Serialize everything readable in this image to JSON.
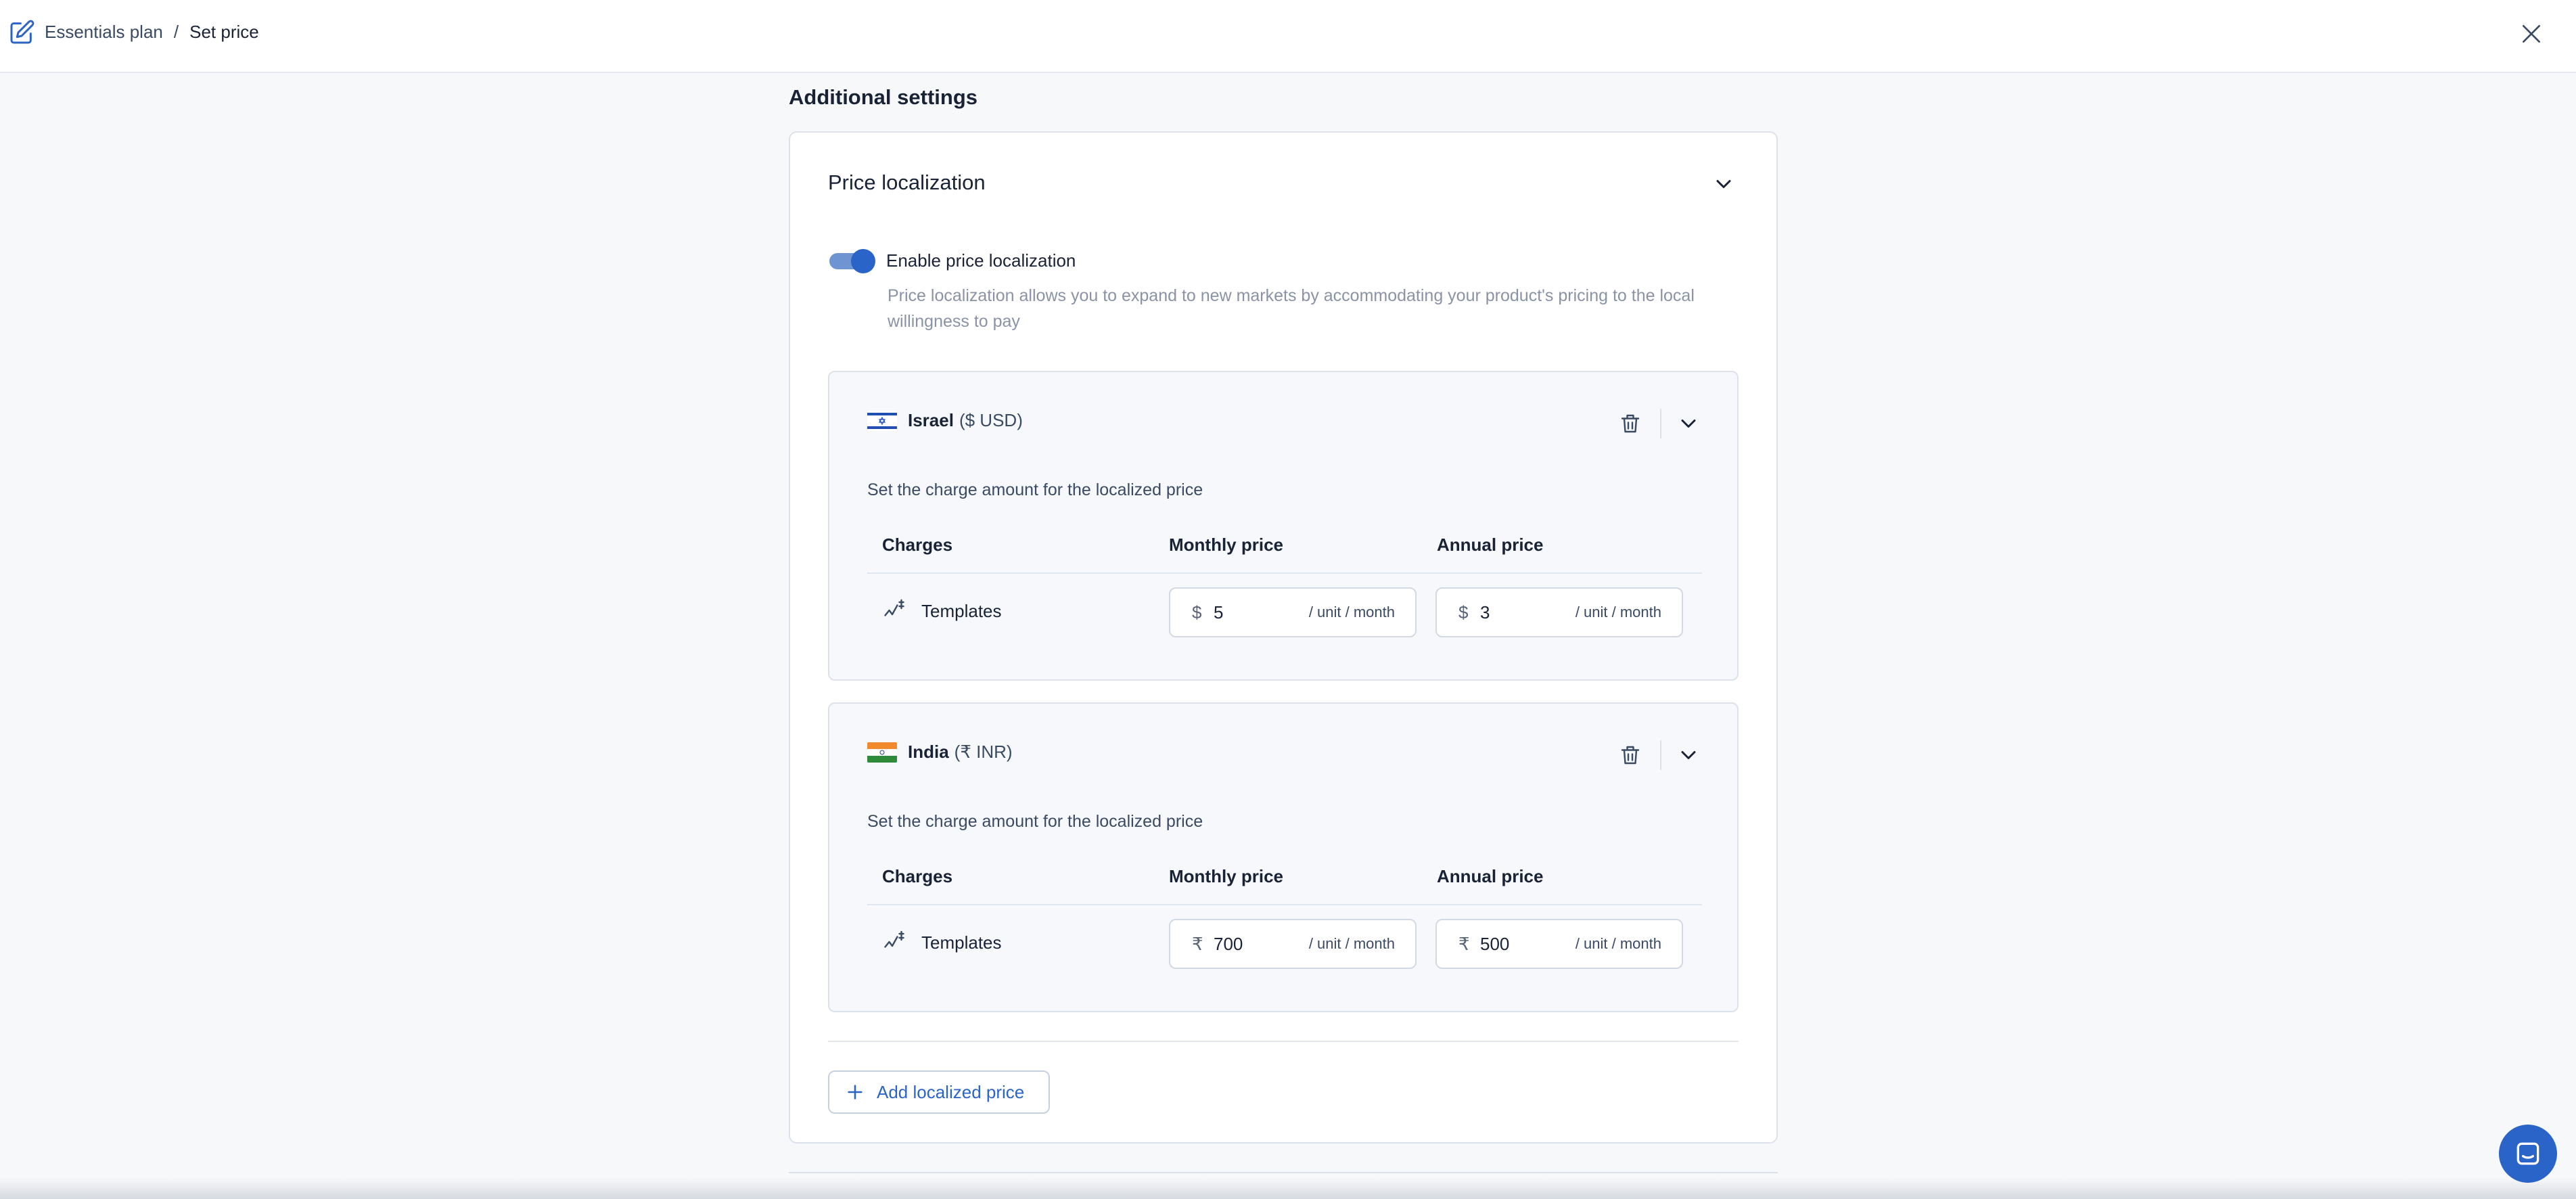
{
  "header": {
    "breadcrumb_parent": "Essentials plan",
    "breadcrumb_separator": "/",
    "breadcrumb_current": "Set price",
    "edit_icon": "edit-icon",
    "close_icon": "close-icon"
  },
  "section": {
    "title": "Additional settings"
  },
  "price_localization": {
    "title": "Price localization",
    "toggle_enabled": true,
    "toggle_label": "Enable price localization",
    "description": "Price localization allows you to expand to new markets by accommodating your product's pricing to the local willingness to pay",
    "countries": [
      {
        "name": "Israel",
        "currency": "($ USD)",
        "subtitle": "Set the charge amount for the localized price",
        "columns": [
          "Charges",
          "Monthly price",
          "Annual price"
        ],
        "charge_label": "Templates",
        "monthly": {
          "symbol": "$",
          "value": "5",
          "unit": "/ unit / month"
        },
        "annual": {
          "symbol": "$",
          "value": "3",
          "unit": "/ unit / month"
        }
      },
      {
        "name": "India",
        "currency": "(₹ INR)",
        "subtitle": "Set the charge amount for the localized price",
        "columns": [
          "Charges",
          "Monthly price",
          "Annual price"
        ],
        "charge_label": "Templates",
        "monthly": {
          "symbol": "₹",
          "value": "700",
          "unit": "/ unit / month"
        },
        "annual": {
          "symbol": "₹",
          "value": "500",
          "unit": "/ unit / month"
        }
      }
    ],
    "add_button_label": "Add localized price"
  },
  "colors": {
    "accent": "#2a64c8",
    "toggle_track": "#6e94d2",
    "text_primary": "#1a2236",
    "text_muted": "#8a93a6"
  }
}
